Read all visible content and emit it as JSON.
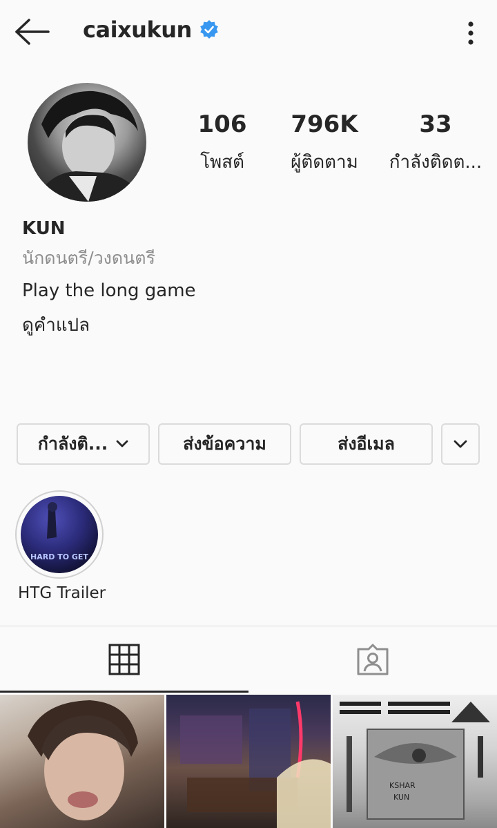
{
  "header": {
    "username": "caixukun",
    "back_icon": "arrow-left-icon",
    "verified_icon": "verified-badge-icon",
    "more_icon": "more-vertical-icon",
    "verified_color": "#3897f0"
  },
  "profile": {
    "stats": [
      {
        "value": "106",
        "label": "โพสต์"
      },
      {
        "value": "796K",
        "label": "ผู้ติดตาม"
      },
      {
        "value": "33",
        "label": "กำลังติดต..."
      }
    ],
    "name": "KUN",
    "category": "นักดนตรี/วงดนตรี",
    "bio": "Play the long game",
    "translate_link": "ดูคำแปล"
  },
  "actions": {
    "following_label": "กำลังติ...",
    "message_label": "ส่งข้อความ",
    "email_label": "ส่งอีเมล"
  },
  "highlights": [
    {
      "label": "HTG Trailer",
      "cover_text": "HARD TO GET"
    }
  ],
  "tabs": {
    "grid_icon": "grid-icon",
    "tagged_icon": "tagged-person-icon"
  },
  "posts": {
    "post3_text_1": "KSHAR",
    "post3_text_2": "KUN"
  }
}
